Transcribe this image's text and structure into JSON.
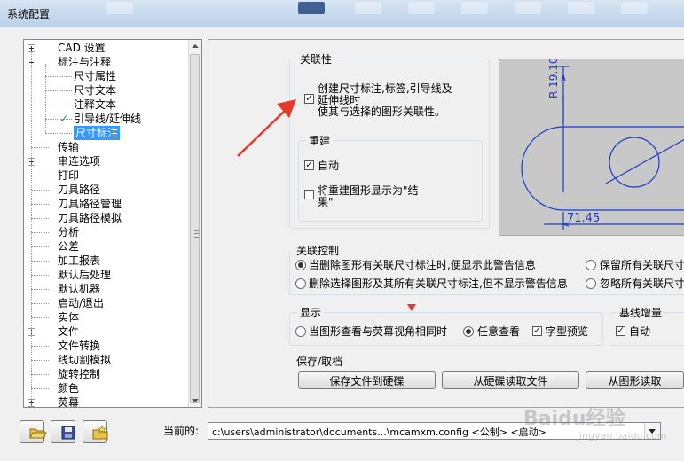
{
  "window": {
    "title": "系统配置"
  },
  "tree": {
    "items": [
      {
        "label": "CAD 设置",
        "level": 0,
        "expander": "plus"
      },
      {
        "label": "标注与注释",
        "level": 0,
        "expander": "minus"
      },
      {
        "label": "尺寸属性",
        "level": 1
      },
      {
        "label": "尺寸文本",
        "level": 1
      },
      {
        "label": "注释文本",
        "level": 1
      },
      {
        "label": "引导线/延伸线",
        "level": 1,
        "checked": true
      },
      {
        "label": "尺寸标注",
        "level": 1,
        "selected": true
      },
      {
        "label": "传输",
        "level": 0
      },
      {
        "label": "串连选项",
        "level": 0,
        "expander": "plus"
      },
      {
        "label": "打印",
        "level": 0
      },
      {
        "label": "刀具路径",
        "level": 0
      },
      {
        "label": "刀具路径管理",
        "level": 0
      },
      {
        "label": "刀具路径模拟",
        "level": 0
      },
      {
        "label": "分析",
        "level": 0
      },
      {
        "label": "公差",
        "level": 0
      },
      {
        "label": "加工报表",
        "level": 0
      },
      {
        "label": "默认后处理",
        "level": 0
      },
      {
        "label": "默认机器",
        "level": 0
      },
      {
        "label": "启动/退出",
        "level": 0
      },
      {
        "label": "实体",
        "level": 0
      },
      {
        "label": "文件",
        "level": 0,
        "expander": "plus"
      },
      {
        "label": "文件转换",
        "level": 0
      },
      {
        "label": "线切割模拟",
        "level": 0
      },
      {
        "label": "旋转控制",
        "level": 0
      },
      {
        "label": "颜色",
        "level": 0
      },
      {
        "label": "荧幕",
        "level": 0,
        "expander": "plus"
      }
    ]
  },
  "association": {
    "title": "关联性",
    "create_checkbox_line1": "创建尺寸标注,标签,引导线及",
    "create_checkbox_line2": "延伸线时",
    "create_checkbox_line3": "使其与选择的图形关联性。",
    "create_checked": true
  },
  "rebuild": {
    "title": "重建",
    "auto_label": "自动",
    "auto_checked": true,
    "show_label_line1": "将重建图形显示为\"结",
    "show_label_line2": "果\"",
    "show_checked": false
  },
  "preview": {
    "dim_radius": "R 19.10",
    "dim_linear": "71.45"
  },
  "association_control": {
    "title": "关联控制",
    "options": [
      {
        "label": "当删除图形有关联尺寸标注时,便显示此警告信息",
        "checked": true
      },
      {
        "label": "保留所有关联尺寸标注",
        "checked": false
      },
      {
        "label": "删除选择图形及其所有关联尺寸标注,但不显示警告信息",
        "checked": false
      },
      {
        "label": "忽略所有关联尺寸",
        "checked": false
      }
    ]
  },
  "display": {
    "title": "显示",
    "option1": "当图形查看与荧幕视角相同时",
    "option2": "任意查看",
    "option2_checked": true,
    "preview_label": "字型预览",
    "preview_checked": true
  },
  "baseline": {
    "title": "基线增量",
    "auto_label": "自动",
    "auto_checked": true
  },
  "save_load": {
    "title": "保存/取档",
    "save_btn": "保存文件到硬碟",
    "load_btn": "从硬碟读取文件",
    "graphics_btn": "从图形读取"
  },
  "bottom": {
    "current_label": "当前的:",
    "current_value": "c:\\users\\administrator\\documents...\\mcamxm.config <公制> <启动>"
  },
  "watermark": {
    "brand": "Baidu经验",
    "url": "jingyan.baidu.com"
  },
  "colors": {
    "selection": "#3399ff",
    "arrow": "#e8372d",
    "preview_bg": "#c8c8c8",
    "preview_line": "#1a3cc8"
  },
  "icons": [
    "open-folder-icon",
    "save-disk-icon",
    "new-folder-icon",
    "checkmark-icon"
  ]
}
